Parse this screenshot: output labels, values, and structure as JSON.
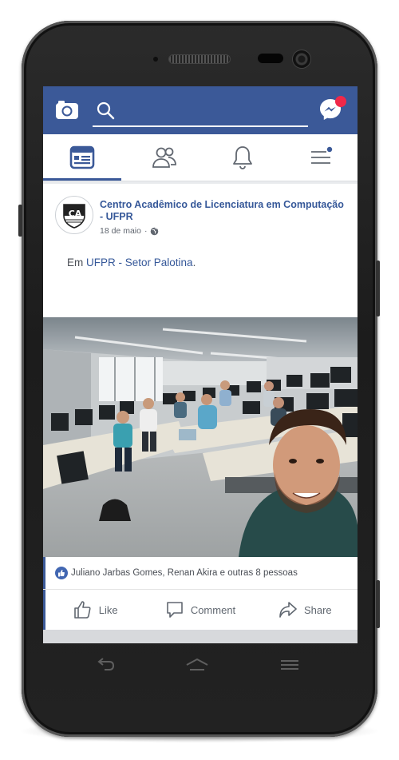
{
  "topbar": {
    "camera_icon": "camera-icon",
    "search_icon": "search-icon",
    "messenger_icon": "messenger-icon",
    "brand_color": "#3b5998",
    "badge_color": "#f02849"
  },
  "nav": {
    "tabs": [
      {
        "icon": "news-feed-icon",
        "active": true
      },
      {
        "icon": "friends-icon",
        "active": false
      },
      {
        "icon": "notifications-bell-icon",
        "active": false
      },
      {
        "icon": "menu-icon",
        "active": false
      }
    ]
  },
  "post": {
    "author": "Centro Acadêmico de Licenciatura em Computação - UFPR",
    "avatar_text": "CA",
    "date": "18 de maio",
    "separator": "·",
    "privacy_icon": "globe-icon",
    "text_prefix": "Em ",
    "text_link": "UFPR - Setor Palotina",
    "text_suffix": ".",
    "likes_text": "Juliano Jarbas Gomes, Renan Akira e outras 8 pessoas",
    "actions": {
      "like": "Like",
      "comment": "Comment",
      "share": "Share"
    }
  },
  "system_nav": {
    "back_icon": "back-icon",
    "home_icon": "home-icon",
    "recents_icon": "recents-icon"
  }
}
